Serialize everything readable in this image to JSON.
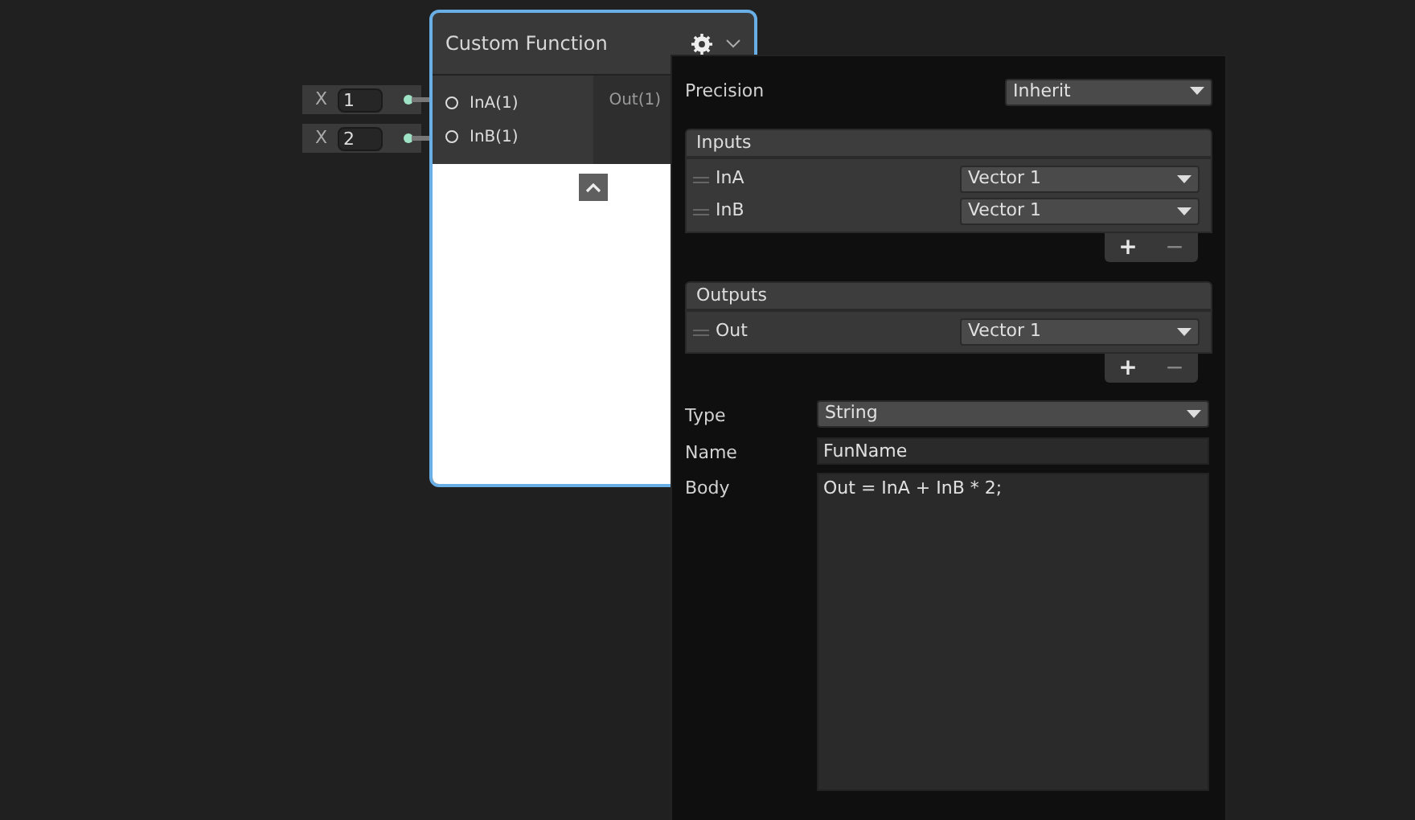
{
  "node": {
    "title": "Custom Function",
    "inputs": [
      {
        "label": "InA(1)",
        "value": "1",
        "axis": "X"
      },
      {
        "label": "InB(1)",
        "value": "2",
        "axis": "X"
      }
    ],
    "outputs": [
      {
        "label": "Out(1)"
      }
    ],
    "preview_expanded": true
  },
  "panel": {
    "precision": {
      "label": "Precision",
      "value": "Inherit"
    },
    "sections": [
      {
        "title": "Inputs",
        "rows": [
          {
            "name": "InA",
            "type": "Vector 1"
          },
          {
            "name": "InB",
            "type": "Vector 1"
          }
        ],
        "add": "+",
        "remove": "−"
      },
      {
        "title": "Outputs",
        "rows": [
          {
            "name": "Out",
            "type": "Vector 1"
          }
        ],
        "add": "+",
        "remove": "−"
      }
    ],
    "type": {
      "label": "Type",
      "value": "String"
    },
    "name": {
      "label": "Name",
      "value": "FunName"
    },
    "body": {
      "label": "Body",
      "value": "Out = InA + InB * 2;"
    }
  }
}
